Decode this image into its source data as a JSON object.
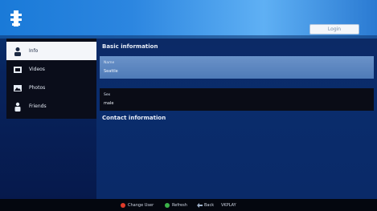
{
  "header": {
    "login_label": "Login"
  },
  "sidebar": {
    "items": [
      {
        "label": "Info",
        "icon": "person-icon"
      },
      {
        "label": "Videos",
        "icon": "video-icon"
      },
      {
        "label": "Photos",
        "icon": "photo-icon"
      },
      {
        "label": "Friends",
        "icon": "friends-icon"
      }
    ]
  },
  "main": {
    "basic_title": "Basic information",
    "contact_title": "Contact information",
    "fields": [
      {
        "label": "Name",
        "value": "Seattle"
      },
      {
        "label": "Sex",
        "value": "male"
      }
    ]
  },
  "bottom": {
    "hints": [
      {
        "label": "Change User",
        "color": "#e03b2a"
      },
      {
        "label": "Refresh",
        "color": "#3bb34a"
      },
      {
        "label": "Back",
        "color": "#9fb2cc"
      },
      {
        "label": "VKPLAY",
        "color": ""
      }
    ]
  },
  "colors": {
    "accent": "#2c86e0",
    "highlight": "#5f88c2"
  }
}
